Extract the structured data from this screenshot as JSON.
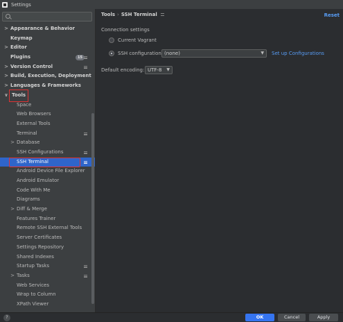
{
  "window": {
    "title": "Settings"
  },
  "sidebar": {
    "search_placeholder": "",
    "items": [
      {
        "label": "Appearance & Behavior",
        "level": 0,
        "bold": true,
        "arrow": ">",
        "icon": ""
      },
      {
        "label": "Keymap",
        "level": 0,
        "bold": true,
        "arrow": "",
        "icon": ""
      },
      {
        "label": "Editor",
        "level": 0,
        "bold": true,
        "arrow": ">",
        "icon": ""
      },
      {
        "label": "Plugins",
        "level": 0,
        "bold": true,
        "arrow": "",
        "icon": "config",
        "badge": "15"
      },
      {
        "label": "Version Control",
        "level": 0,
        "bold": true,
        "arrow": ">",
        "icon": "config"
      },
      {
        "label": "Build, Execution, Deployment",
        "level": 0,
        "bold": true,
        "arrow": ">",
        "icon": ""
      },
      {
        "label": "Languages & Frameworks",
        "level": 0,
        "bold": true,
        "arrow": ">",
        "icon": ""
      },
      {
        "label": "Tools",
        "level": 0,
        "bold": true,
        "arrow": "∨",
        "icon": "",
        "highlight": "tools"
      },
      {
        "label": "Space",
        "level": 1,
        "arrow": "",
        "icon": ""
      },
      {
        "label": "Web Browsers",
        "level": 1,
        "arrow": "",
        "icon": ""
      },
      {
        "label": "External Tools",
        "level": 1,
        "arrow": "",
        "icon": ""
      },
      {
        "label": "Terminal",
        "level": 1,
        "arrow": "",
        "icon": "config"
      },
      {
        "label": "Database",
        "level": 1,
        "arrow": ">",
        "icon": ""
      },
      {
        "label": "SSH Configurations",
        "level": 1,
        "arrow": "",
        "icon": "config"
      },
      {
        "label": "SSH Terminal",
        "level": 1,
        "arrow": "",
        "icon": "config",
        "selected": true,
        "highlight": "ssh"
      },
      {
        "label": "Android Device File Explorer",
        "level": 1,
        "arrow": "",
        "icon": ""
      },
      {
        "label": "Android Emulator",
        "level": 1,
        "arrow": "",
        "icon": ""
      },
      {
        "label": "Code With Me",
        "level": 1,
        "arrow": "",
        "icon": ""
      },
      {
        "label": "Diagrams",
        "level": 1,
        "arrow": "",
        "icon": ""
      },
      {
        "label": "Diff & Merge",
        "level": 1,
        "arrow": ">",
        "icon": ""
      },
      {
        "label": "Features Trainer",
        "level": 1,
        "arrow": "",
        "icon": ""
      },
      {
        "label": "Remote SSH External Tools",
        "level": 1,
        "arrow": "",
        "icon": ""
      },
      {
        "label": "Server Certificates",
        "level": 1,
        "arrow": "",
        "icon": ""
      },
      {
        "label": "Settings Repository",
        "level": 1,
        "arrow": "",
        "icon": ""
      },
      {
        "label": "Shared Indexes",
        "level": 1,
        "arrow": "",
        "icon": ""
      },
      {
        "label": "Startup Tasks",
        "level": 1,
        "arrow": "",
        "icon": "config"
      },
      {
        "label": "Tasks",
        "level": 1,
        "arrow": ">",
        "icon": "config"
      },
      {
        "label": "Web Services",
        "level": 1,
        "arrow": "",
        "icon": ""
      },
      {
        "label": "Wrap to Column",
        "level": 1,
        "arrow": "",
        "icon": ""
      },
      {
        "label": "XPath Viewer",
        "level": 1,
        "arrow": "",
        "icon": ""
      }
    ]
  },
  "content": {
    "breadcrumb": {
      "parent": "Tools",
      "separator": "›",
      "current": "SSH Terminal"
    },
    "reset_label": "Reset",
    "connection_settings_label": "Connection settings",
    "option_vagrant": "Current Vagrant",
    "option_ssh": "SSH configuration",
    "ssh_config_value": "(none)",
    "setup_link": "Set up Configurations",
    "encoding_label": "Default encoding:",
    "encoding_value": "UTF-8"
  },
  "footer": {
    "help_label": "?",
    "ok_label": "OK",
    "cancel_label": "Cancel",
    "apply_label": "Apply"
  },
  "colors": {
    "accent": "#2f65ca",
    "link": "#589df6",
    "highlight_box": "#e03333",
    "ok_button": "#3574f0"
  }
}
